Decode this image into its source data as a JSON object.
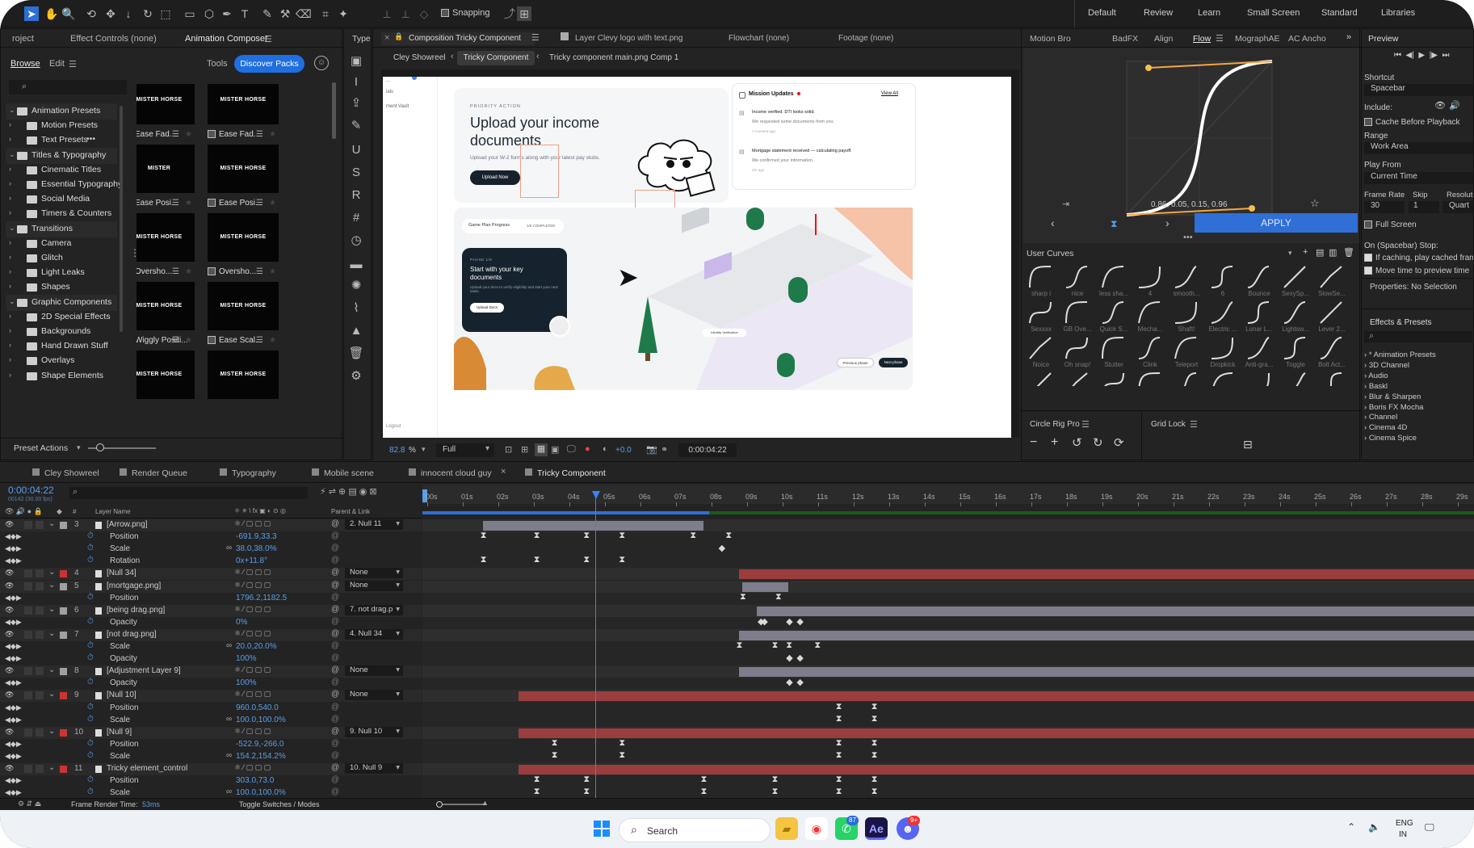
{
  "topbar": {
    "snapping_label": "Snapping",
    "workspaces": [
      "Default",
      "Review",
      "Learn",
      "Small Screen",
      "Standard",
      "Libraries"
    ]
  },
  "left_panel": {
    "tabs": [
      "roject",
      "Effect Controls (none)",
      "Animation Composer"
    ],
    "subtabs": {
      "browse": "Browse",
      "edit": "Edit",
      "tools": "Tools",
      "discover": "Discover Packs"
    },
    "tree": [
      {
        "label": "Animation Presets",
        "level": 0
      },
      {
        "label": "Motion Presets",
        "level": 1
      },
      {
        "label": "Text Presets",
        "level": 1
      },
      {
        "label": "Titles & Typography",
        "level": 0
      },
      {
        "label": "Cinematic Titles",
        "level": 1
      },
      {
        "label": "Essential Typography",
        "level": 1
      },
      {
        "label": "Social Media",
        "level": 1
      },
      {
        "label": "Timers & Counters",
        "level": 1
      },
      {
        "label": "Transitions",
        "level": 0
      },
      {
        "label": "Camera",
        "level": 1
      },
      {
        "label": "Glitch",
        "level": 1
      },
      {
        "label": "Light Leaks",
        "level": 1
      },
      {
        "label": "Shapes",
        "level": 1
      },
      {
        "label": "Graphic Components",
        "level": 0
      },
      {
        "label": "2D Special Effects",
        "level": 1
      },
      {
        "label": "Backgrounds",
        "level": 1
      },
      {
        "label": "Hand Drawn Stuff",
        "level": 1
      },
      {
        "label": "Overlays",
        "level": 1
      },
      {
        "label": "Shape Elements",
        "level": 1
      }
    ],
    "thumbs": [
      {
        "text": "MISTER HORSE",
        "caption": "Ease Fad..."
      },
      {
        "text": "MISTER HORSE",
        "caption": "Ease Fad..."
      },
      {
        "text": "MISTER",
        "caption": "Ease Posi..."
      },
      {
        "text": "MISTER HORSE",
        "caption": "Ease Posi..."
      },
      {
        "text": "MISTER HORSE",
        "caption": "Oversho..."
      },
      {
        "text": "MISTER HORSE",
        "caption": "Oversho..."
      },
      {
        "text": "MISTER HORSE",
        "caption": "Wiggly Positi..."
      },
      {
        "text": "MISTER HORSE",
        "caption": "Ease Scal..."
      },
      {
        "text": "MISTER HORSE",
        "caption": ""
      },
      {
        "text": "MISTER HORSE",
        "caption": ""
      }
    ],
    "preset_actions": "Preset Actions"
  },
  "tools_panel": {
    "title": "Type"
  },
  "composition": {
    "tabs": [
      "Composition Tricky Component",
      "Layer Clevy logo with text.png",
      "Flowchart (none)",
      "Footage (none)"
    ],
    "breadcrumbs": [
      "Cley Showreel",
      "Tricky Component",
      "Tricky component main.png Comp 1"
    ],
    "zoom": "82.8",
    "zoom_unit": "%",
    "resolution": "Full",
    "exposure": "+0.0",
    "timecode": "0:00:04:22"
  },
  "mockup": {
    "sidebar_items": [
      "...",
      "ials",
      "ment Vault"
    ],
    "sidebar_footer": "Logout",
    "kicker": "PRIORITY ACTION",
    "headline": "Upload your income documents",
    "subtext": "Upload your W-2 forms along with your latest pay stubs.",
    "cta": "Upload Now",
    "mission_title": "Mission Updates",
    "view_all": "View All",
    "missions": [
      {
        "title": "Income verified. DTI looks solid.",
        "body": "We requested some documents from you.",
        "time": "A moment ago"
      },
      {
        "title": "Mortgage statement received — calculating payoff.",
        "body": "We confirmed your information.",
        "time": "2hr ago"
      }
    ],
    "progress_title": "Game Plan Progress",
    "progress_badge": "1/6 COMPLETED",
    "card_kicker": "PHASE 1/6",
    "card_title": "Start with your key documents",
    "card_body": "Upload your docs to verify eligibility and start your next tasks.",
    "card_cta": "Upload Docs",
    "identity": "Identity Verification",
    "prev": "Previous phase",
    "next": "Next phase"
  },
  "flow_panel": {
    "tabs": [
      "Motion Bro",
      "BadFX",
      "Align",
      "Flow",
      "MographAE",
      "AC Ancho"
    ],
    "bezier": "0.86, 0.05, 0.15, 0.96",
    "apply": "APPLY",
    "user_curves": "User Curves",
    "curve_labels": [
      "sharp i",
      "nice",
      "less sha...",
      "4",
      "smooth...",
      "6",
      "Bounce",
      "SexySp...",
      "SlowSe...",
      "Sexxxx",
      "GB Ove...",
      "Quick S...",
      "Mecha...",
      "Shaft!",
      "Electric ...",
      "Lunar L...",
      "Lightsw...",
      "Lever 2...",
      "Noice",
      "Oh snap!",
      "Stutter",
      "Clink",
      "Teleport",
      "Dropkick",
      "Anti-gra...",
      "Toggle",
      "Bolt Act...",
      "",
      "",
      "",
      "",
      "",
      "",
      "",
      "",
      ""
    ],
    "circle_rig": "Circle Rig Pro",
    "grid_lock": "Grid Lock"
  },
  "preview_panel": {
    "title": "Preview",
    "shortcut_label": "Shortcut",
    "shortcut": "Spacebar",
    "include": "Include:",
    "cache": "Cache Before Playback",
    "range_label": "Range",
    "range": "Work Area",
    "play_from_label": "Play From",
    "play_from": "Current Time",
    "frame_rate_label": "Frame Rate",
    "skip_label": "Skip",
    "resolution_label": "Resolutio",
    "frame_rate": "30",
    "skip": "1",
    "resolution": "Quart",
    "full_screen": "Full Screen",
    "stop_label": "On (Spacebar) Stop:",
    "stop_opt1": "If caching, play cached frame",
    "stop_opt2": "Move time to preview time",
    "properties": "Properties: No Selection",
    "effects_title": "Effects & Presets",
    "effects": [
      "* Animation Presets",
      "3D Channel",
      "Audio",
      "Baskl",
      "Blur & Sharpen",
      "Boris FX Mocha",
      "Channel",
      "Cinema 4D",
      "Cinema Spice"
    ]
  },
  "timeline": {
    "tabs": [
      "Cley Showreel",
      "Render Queue",
      "Typography",
      "Mobile scene",
      "innocent cloud guy",
      "Tricky Component"
    ],
    "time": "0:00:04:22",
    "frames": "00142 (30.00 fps)",
    "col_layer": "Layer Name",
    "col_parent": "Parent & Link",
    "ruler": [
      "00s",
      "01s",
      "02s",
      "03s",
      "04s",
      "05s",
      "06s",
      "07s",
      "08s",
      "09s",
      "10s",
      "11s",
      "12s",
      "13s",
      "14s",
      "15s",
      "16s",
      "17s",
      "18s",
      "19s",
      "20s",
      "21s",
      "22s",
      "23s",
      "24s",
      "25s",
      "26s",
      "27s",
      "28s",
      "29s"
    ],
    "rows": [
      {
        "kind": "layer",
        "num": "3",
        "name": "[Arrow.png]",
        "color": "#a0a0a0",
        "parent": "2. Null 11"
      },
      {
        "kind": "prop",
        "name": "Position",
        "value": "-691.9,33.3"
      },
      {
        "kind": "prop",
        "name": "Scale",
        "value": "38.0,38.0%"
      },
      {
        "kind": "prop",
        "name": "Rotation",
        "value": "0x+11.8°"
      },
      {
        "kind": "layer",
        "num": "4",
        "name": "[Null 34]",
        "color": "#c33",
        "parent": "None"
      },
      {
        "kind": "layer",
        "num": "5",
        "name": "[mortgage.png]",
        "color": "#a0a0a0",
        "parent": "None"
      },
      {
        "kind": "prop",
        "name": "Position",
        "value": "1796.2,1182.5"
      },
      {
        "kind": "layer",
        "num": "6",
        "name": "[being drag.png]",
        "color": "#a0a0a0",
        "parent": "7. not drag.p"
      },
      {
        "kind": "prop",
        "name": "Opacity",
        "value": "0%"
      },
      {
        "kind": "layer",
        "num": "7",
        "name": "[not drag.png]",
        "color": "#a0a0a0",
        "parent": "4. Null 34"
      },
      {
        "kind": "prop",
        "name": "Scale",
        "value": "20.0,20.0%"
      },
      {
        "kind": "prop",
        "name": "Opacity",
        "value": "100%"
      },
      {
        "kind": "layer",
        "num": "8",
        "name": "[Adjustment Layer 9]",
        "color": "#a0a0a0",
        "parent": "None"
      },
      {
        "kind": "prop",
        "name": "Opacity",
        "value": "100%"
      },
      {
        "kind": "layer",
        "num": "9",
        "name": "[Null 10]",
        "color": "#c33",
        "parent": "None"
      },
      {
        "kind": "prop",
        "name": "Position",
        "value": "960.0,540.0"
      },
      {
        "kind": "prop",
        "name": "Scale",
        "value": "100.0,100.0%"
      },
      {
        "kind": "layer",
        "num": "10",
        "name": "[Null 9]",
        "color": "#c33",
        "parent": "9. Null 10"
      },
      {
        "kind": "prop",
        "name": "Position",
        "value": "-522.9,-266.0"
      },
      {
        "kind": "prop",
        "name": "Scale",
        "value": "154.2,154.2%"
      },
      {
        "kind": "layer",
        "num": "11",
        "name": "Tricky element_control",
        "color": "#c33",
        "parent": "10. Null 9"
      },
      {
        "kind": "prop",
        "name": "Position",
        "value": "303.0,73.0"
      },
      {
        "kind": "prop",
        "name": "Scale",
        "value": "100.0,100.0%"
      }
    ],
    "render_time_label": "Frame Render Time:",
    "render_time": "53ms",
    "toggle": "Toggle Switches / Modes"
  },
  "taskbar": {
    "search": "Search",
    "lang1": "ENG",
    "lang2": "IN",
    "whatsapp_badge": "87",
    "discord_badge": "9+"
  }
}
